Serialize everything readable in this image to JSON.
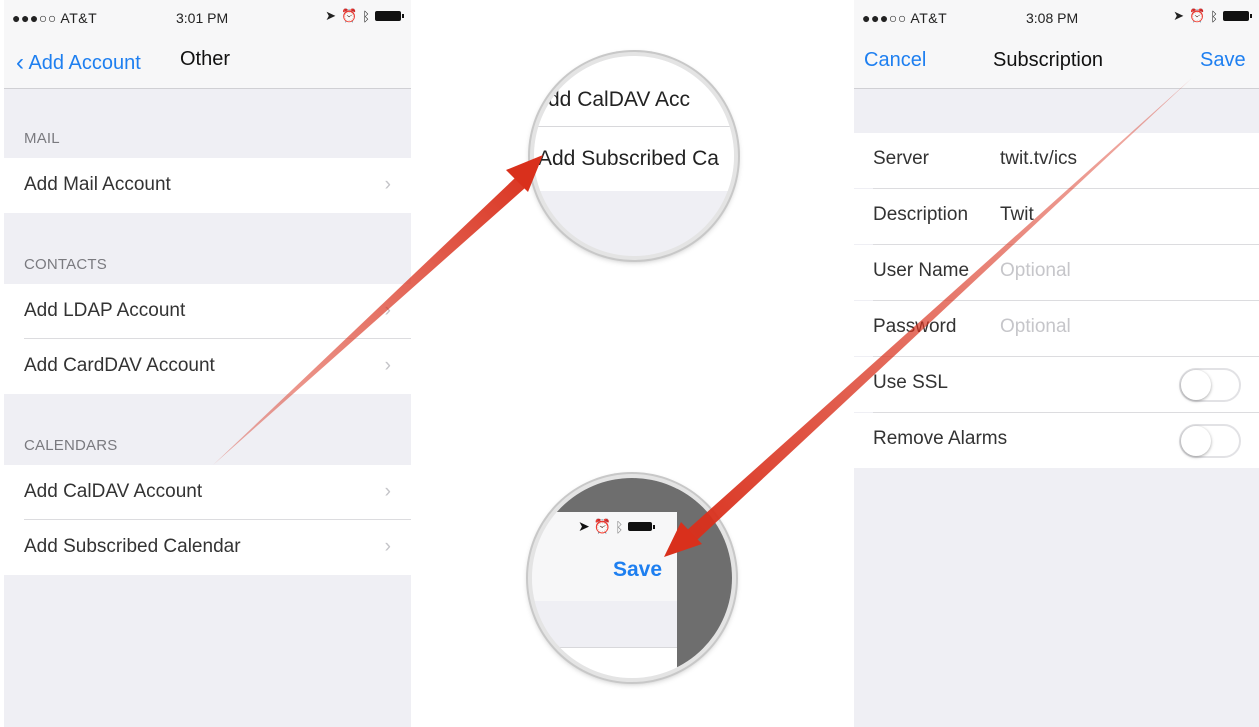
{
  "left_screen": {
    "status": {
      "carrier": "●●●○○ AT&T",
      "time": "3:01 PM"
    },
    "nav": {
      "back_label": "Add Account",
      "title": "Other"
    },
    "sections": [
      {
        "title": "MAIL",
        "rows": [
          "Add Mail Account"
        ]
      },
      {
        "title": "CONTACTS",
        "rows": [
          "Add LDAP Account",
          "Add CardDAV Account"
        ]
      },
      {
        "title": "CALENDARS",
        "rows": [
          "Add CalDAV Account",
          "Add Subscribed Calendar"
        ]
      }
    ]
  },
  "zoom_top": {
    "row1": "dd CalDAV Acc",
    "row2": "Add Subscribed Ca"
  },
  "zoom_bottom": {
    "save_label": "Save"
  },
  "right_screen": {
    "status": {
      "carrier": "●●●○○ AT&T",
      "time": "3:08 PM"
    },
    "nav": {
      "cancel_label": "Cancel",
      "title": "Subscription",
      "save_label": "Save"
    },
    "fields": [
      {
        "label": "Server",
        "value": "twit.tv/ics",
        "placeholder": false
      },
      {
        "label": "Description",
        "value": "Twit",
        "placeholder": false
      },
      {
        "label": "User Name",
        "value": "Optional",
        "placeholder": true
      },
      {
        "label": "Password",
        "value": "Optional",
        "placeholder": true
      }
    ],
    "toggles": [
      {
        "label": "Use SSL",
        "on": false
      },
      {
        "label": "Remove Alarms",
        "on": false
      }
    ]
  },
  "colors": {
    "ios_blue": "#1e7ff0",
    "arrow_red": "#d9301c",
    "grouped_bg": "#efeff4"
  },
  "icons": {
    "back": "chevron-left-icon",
    "disclosure": "chevron-right-icon",
    "wifi": "wifi-icon",
    "location": "location-arrow-icon",
    "alarm": "alarm-icon",
    "bluetooth": "bluetooth-icon",
    "battery": "battery-icon"
  }
}
